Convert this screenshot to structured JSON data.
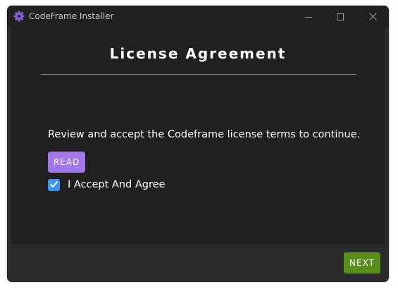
{
  "window": {
    "title": "CodeFrame Installer",
    "icon": "gear-icon",
    "controls": [
      "minimize-icon",
      "maximize-icon",
      "close-icon"
    ]
  },
  "main": {
    "heading": "License Agreement",
    "instruction": "Review and accept the Codeframe license terms to continue.",
    "read_button": "READ",
    "accept_checkbox": {
      "label": "I Accept And Agree",
      "checked": true
    }
  },
  "footer": {
    "next_button": "NEXT"
  },
  "colors": {
    "window_bg": "#2b2b2b",
    "content_bg": "#202020",
    "read_button": "#a078e8",
    "checkbox": "#3b96f0",
    "next_button": "#5a8c1e",
    "app_icon": "#8a5ce0"
  }
}
